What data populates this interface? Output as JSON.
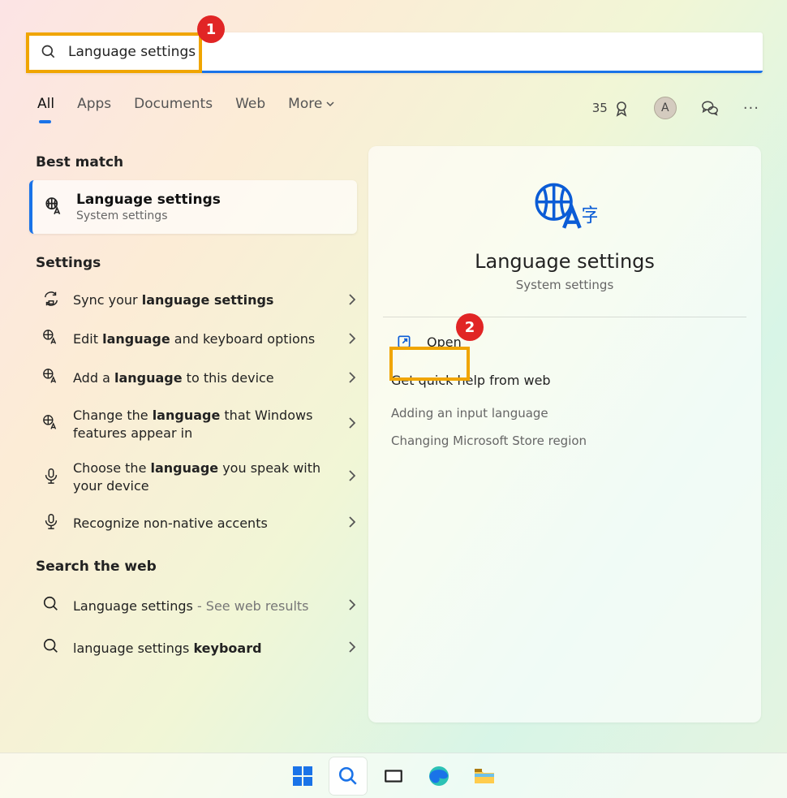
{
  "search": {
    "value": "Language settings"
  },
  "tabs": {
    "all": "All",
    "apps": "Apps",
    "documents": "Documents",
    "web": "Web",
    "more": "More"
  },
  "header": {
    "rewards": "35",
    "avatar": "A"
  },
  "left": {
    "best_match_h": "Best match",
    "best": {
      "title": "Language settings",
      "sub": "System settings"
    },
    "settings_h": "Settings",
    "items": [
      {
        "pre": "Sync your ",
        "bold": "language settings",
        "post": ""
      },
      {
        "pre": "Edit ",
        "bold": "language",
        "post": " and keyboard options"
      },
      {
        "pre": "Add a ",
        "bold": "language",
        "post": " to this device"
      },
      {
        "pre": "Change the ",
        "bold": "language",
        "post": " that Windows features appear in"
      },
      {
        "pre": "Choose the ",
        "bold": "language",
        "post": " you speak with your device"
      },
      {
        "pre": "Recognize non-native accents",
        "bold": "",
        "post": ""
      }
    ],
    "web_h": "Search the web",
    "web_items": [
      {
        "pre": "Language settings",
        "suf": " - See web results"
      },
      {
        "pre": "language settings ",
        "bold": "keyboard"
      }
    ]
  },
  "detail": {
    "title": "Language settings",
    "sub": "System settings",
    "open": "Open",
    "help_h": "Get quick help from web",
    "help": [
      "Adding an input language",
      "Changing Microsoft Store region"
    ]
  },
  "annotations": {
    "one": "1",
    "two": "2"
  }
}
